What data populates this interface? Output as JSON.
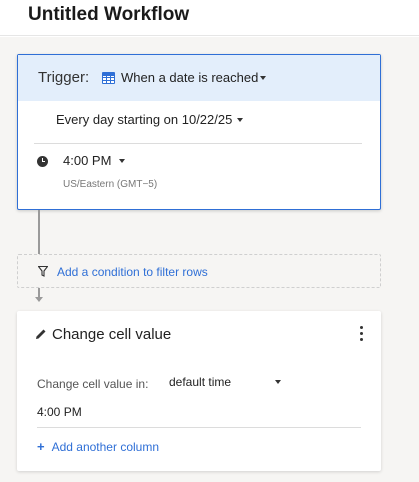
{
  "header": {
    "title": "Untitled Workflow"
  },
  "trigger": {
    "label": "Trigger:",
    "icon": "calendar-icon",
    "value": "When a date is reached",
    "schedule": "Every day starting on 10/22/25",
    "time": "4:00 PM",
    "timezone": "US/Eastern (GMT−5)"
  },
  "filter": {
    "icon": "filter-icon",
    "label": "Add a condition to filter rows"
  },
  "action": {
    "icon": "pencil-icon",
    "title": "Change cell value",
    "column_label": "Change cell value in:",
    "column_value": "default time",
    "cell_value": "4:00 PM",
    "add_column_label": "Add another column",
    "add_icon": "plus-icon"
  },
  "colors": {
    "accent": "#2f6fd6",
    "trigger_header_bg": "#e3eefb",
    "canvas_bg": "#f6f5f3"
  }
}
